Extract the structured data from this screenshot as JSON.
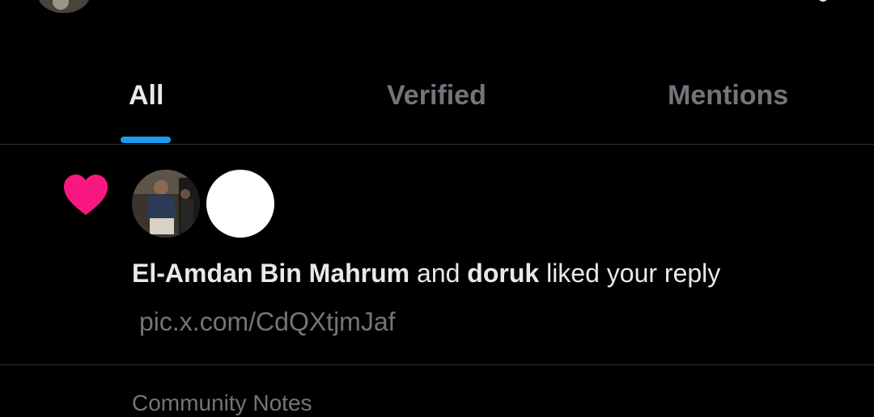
{
  "header": {
    "avatar_icon": "profile-avatar-icon",
    "right_icon": "settings-icon"
  },
  "tabs": [
    {
      "label": "All",
      "active": true
    },
    {
      "label": "Verified",
      "active": false
    },
    {
      "label": "Mentions",
      "active": false
    }
  ],
  "colors": {
    "background": "#000000",
    "accent": "#1d9bf0",
    "like": "#f91880",
    "text_primary": "#e7e9ea",
    "text_secondary": "#71767b",
    "divider": "#2f3336"
  },
  "notification": {
    "icon": "heart-icon",
    "user1": "El-Amdan Bin Mahrum",
    "conjunction": "and",
    "user2": "doruk",
    "action": "liked your reply",
    "link": "pic.x.com/CdQXtjmJaf"
  },
  "next_item": {
    "label": "Community Notes"
  }
}
